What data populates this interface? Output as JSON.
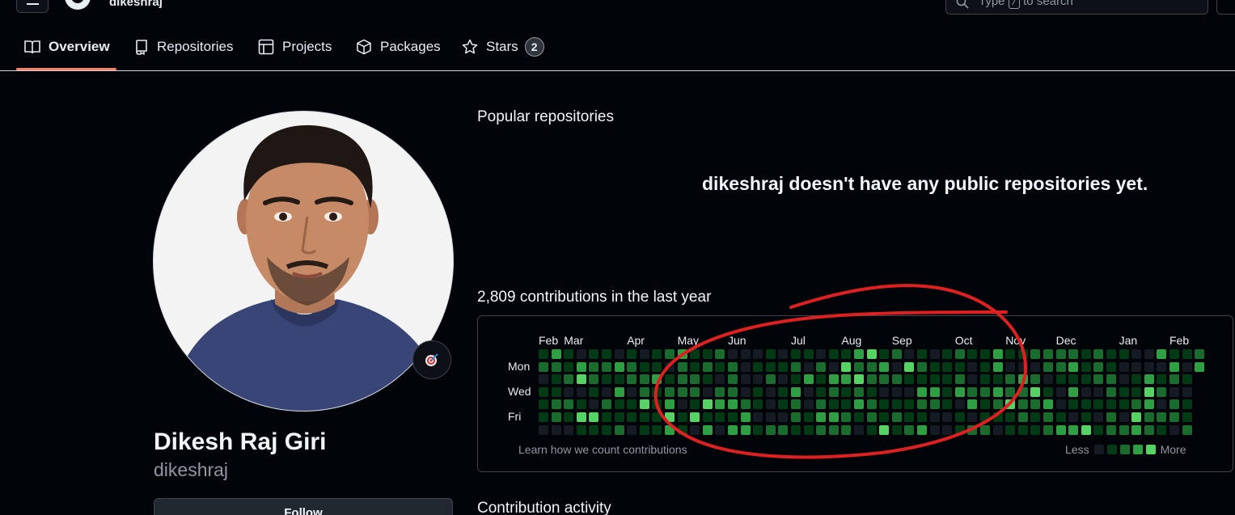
{
  "header": {
    "username": "dikeshraj",
    "search_placeholder_pre": "Type",
    "search_key": "/",
    "search_placeholder_post": "to search"
  },
  "tabs": [
    {
      "label": "Overview",
      "icon": "book-icon",
      "active": true
    },
    {
      "label": "Repositories",
      "icon": "repo-icon"
    },
    {
      "label": "Projects",
      "icon": "table-icon"
    },
    {
      "label": "Packages",
      "icon": "package-icon"
    },
    {
      "label": "Stars",
      "icon": "star-icon",
      "count": "2"
    }
  ],
  "profile": {
    "full_name": "Dikesh Raj Giri",
    "login": "dikeshraj",
    "follow_label": "Follow",
    "status_icon": "target-emoji-icon"
  },
  "popular": {
    "title": "Popular repositories",
    "empty_message": "dikeshraj doesn't have any public repositories yet."
  },
  "contributions": {
    "title": "2,809 contributions in the last year",
    "months": [
      "Feb",
      "Mar",
      "Apr",
      "May",
      "Jun",
      "Jul",
      "Aug",
      "Sep",
      "Oct",
      "Nov",
      "Dec",
      "Jan",
      "Feb"
    ],
    "month_week_index": [
      0,
      2,
      7,
      11,
      15,
      20,
      24,
      28,
      33,
      37,
      41,
      46,
      50
    ],
    "day_labels": [
      "Mon",
      "Wed",
      "Fri"
    ],
    "weeks": 53,
    "learn_link": "Learn how we count contributions",
    "legend_less": "Less",
    "legend_more": "More",
    "level_colors": [
      "#151b23",
      "#033a16",
      "#196c2e",
      "#2ea043",
      "#56d364"
    ]
  },
  "activity": {
    "title": "Contribution activity"
  },
  "annotation_color": "#e02020"
}
